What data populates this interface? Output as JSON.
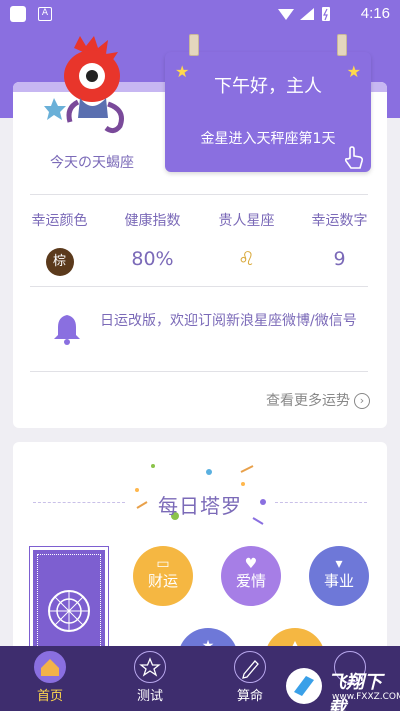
{
  "status_bar": {
    "time": "4:16",
    "left_badge": "A"
  },
  "header": {
    "sign_label": "今天の天蝎座",
    "greeting": "下午好，主人",
    "astro_message": "金星进入天秤座第1天"
  },
  "stats": [
    {
      "label": "幸运颜色",
      "value": "棕"
    },
    {
      "label": "健康指数",
      "value": "80%"
    },
    {
      "label": "贵人星座",
      "value": "♌"
    },
    {
      "label": "幸运数字",
      "value": "9"
    }
  ],
  "notice": "日运改版，欢迎订阅新浪星座微博/微信号",
  "more_link": "查看更多运势",
  "tarot": {
    "title": "每日塔罗",
    "categories": [
      "财运",
      "爱情",
      "事业"
    ]
  },
  "nav": {
    "items": [
      {
        "label": "首页",
        "active": true
      },
      {
        "label": "测试",
        "active": false
      },
      {
        "label": "算命",
        "active": false
      },
      {
        "label": "",
        "active": false
      }
    ]
  },
  "watermark": {
    "title": "飞翔下载",
    "url": "www.FXXZ.COM"
  },
  "colors": {
    "primary": "#8a6fe0",
    "text_purple": "#7b6ab8",
    "nav_bg": "#3e2d6e",
    "accent_yellow": "#ffd84d"
  }
}
